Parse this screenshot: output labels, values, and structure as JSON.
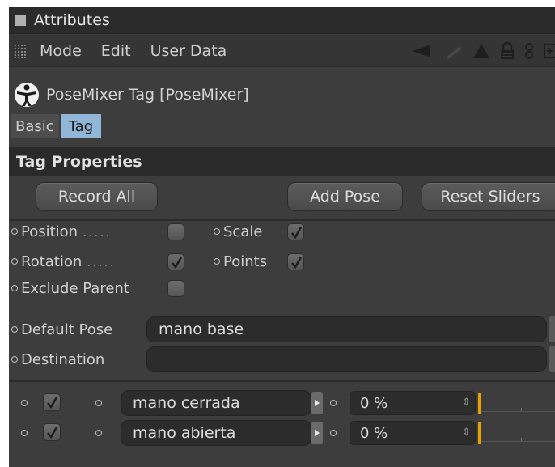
{
  "window": {
    "title": "Attributes"
  },
  "menu": {
    "mode": "Mode",
    "edit": "Edit",
    "user_data": "User Data"
  },
  "object": {
    "title": "PoseMixer Tag [PoseMixer]"
  },
  "tabs": {
    "basic": "Basic",
    "tag": "Tag"
  },
  "section": {
    "title": "Tag Properties"
  },
  "buttons": {
    "record_all": "Record All",
    "add_pose": "Add Pose",
    "reset_sliders": "Reset Sliders"
  },
  "options": {
    "position": {
      "label": "Position",
      "dots": ".....",
      "checked": false
    },
    "scale": {
      "label": "Scale",
      "checked": true
    },
    "rotation": {
      "label": "Rotation",
      "dots": ".....",
      "checked": true
    },
    "points": {
      "label": "Points",
      "checked": true
    },
    "exclude_parent": {
      "label": "Exclude Parent",
      "checked": false
    }
  },
  "fields": {
    "default_pose": {
      "label": "Default Pose",
      "value": "mano base"
    },
    "destination": {
      "label": "Destination",
      "value": ""
    }
  },
  "poses": [
    {
      "enabled": true,
      "name": "mano cerrada",
      "percent": "0 %",
      "strength": 0
    },
    {
      "enabled": true,
      "name": "mano abierta",
      "percent": "0 %",
      "strength": 0
    }
  ],
  "colors": {
    "panel": "#3d3d3d",
    "tab_active": "#92b6d8",
    "slider_marker": "#e8a200"
  }
}
